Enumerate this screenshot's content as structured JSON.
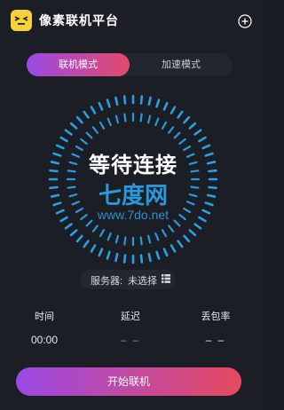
{
  "header": {
    "app_title": "像素联机平台",
    "logo_icon": "pixel-face-logo",
    "add_icon": "plus-circle-icon"
  },
  "tabs": [
    {
      "label": "联机模式",
      "active": true
    },
    {
      "label": "加速模式",
      "active": false
    }
  ],
  "dial": {
    "status_text": "等待连接",
    "watermark_text": "七度网",
    "watermark_url": "www.7do.net"
  },
  "server": {
    "label": "服务器:",
    "value": "未选择",
    "icon": "grid-list-icon"
  },
  "stats": {
    "time": {
      "label": "时间",
      "value": "00:00"
    },
    "latency": {
      "label": "延迟",
      "value": "– –"
    },
    "loss": {
      "label": "丢包率",
      "value": "– –"
    }
  },
  "connect_button": {
    "label": "开始联机"
  },
  "colors": {
    "background": "#1b1e25",
    "accent_start": "#9b49e6",
    "accent_end": "#e64a5f",
    "dial_blue": "#2aa7ee",
    "logo_yellow": "#f6d23a",
    "latency_green": "#3fbf6a"
  }
}
